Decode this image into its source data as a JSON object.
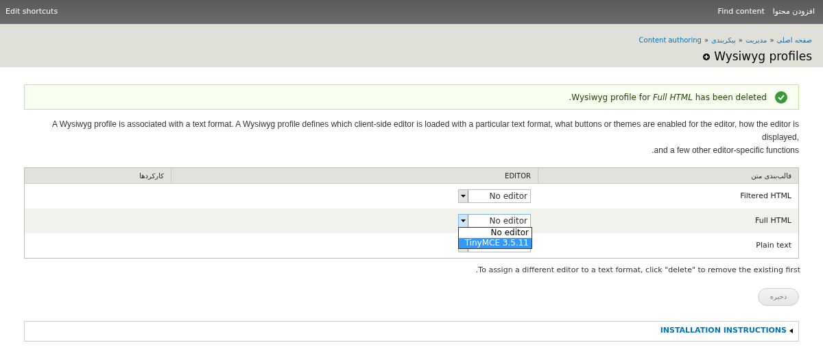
{
  "toolbar": {
    "left_link": "Edit shortcuts",
    "right_links": [
      "Find content",
      "افزودن محتوا"
    ]
  },
  "breadcrumb": [
    "صفحه اصلی",
    "مدیریت",
    "پیکربندی",
    "Content authoring"
  ],
  "breadcrumb_separator": "»",
  "page_title": "Wysiwyg profiles",
  "message": {
    "kind": "status",
    "text": ".Wysiwyg profile for *Full HTML* has been deleted"
  },
  "description_lines": [
    "A Wysiwyg profile is associated with a text format. A Wysiwyg profile defines which client-side editor is loaded with a particular text format, what buttons or themes are enabled for the editor, how the editor is displayed,",
    ".and a few other editor-specific functions"
  ],
  "table": {
    "columns": [
      "قالب‌بندی متن",
      "EDITOR",
      "کارکردها"
    ],
    "rows": [
      {
        "format": "Filtered HTML",
        "editor": "No editor"
      },
      {
        "format": "Full HTML",
        "editor": "No editor",
        "options": [
          {
            "label": "No editor",
            "selected": false
          },
          {
            "label": "TinyMCE 3.5.11",
            "selected": true
          }
        ]
      },
      {
        "format": "Plain text"
      }
    ]
  },
  "hint": ".To assign a different editor to a text format, click \"delete\" to remove the existing first",
  "save_button": "ذخیره",
  "fieldset": {
    "title": "INSTALLATION INSTRUCTIONS",
    "expanded": false
  }
}
